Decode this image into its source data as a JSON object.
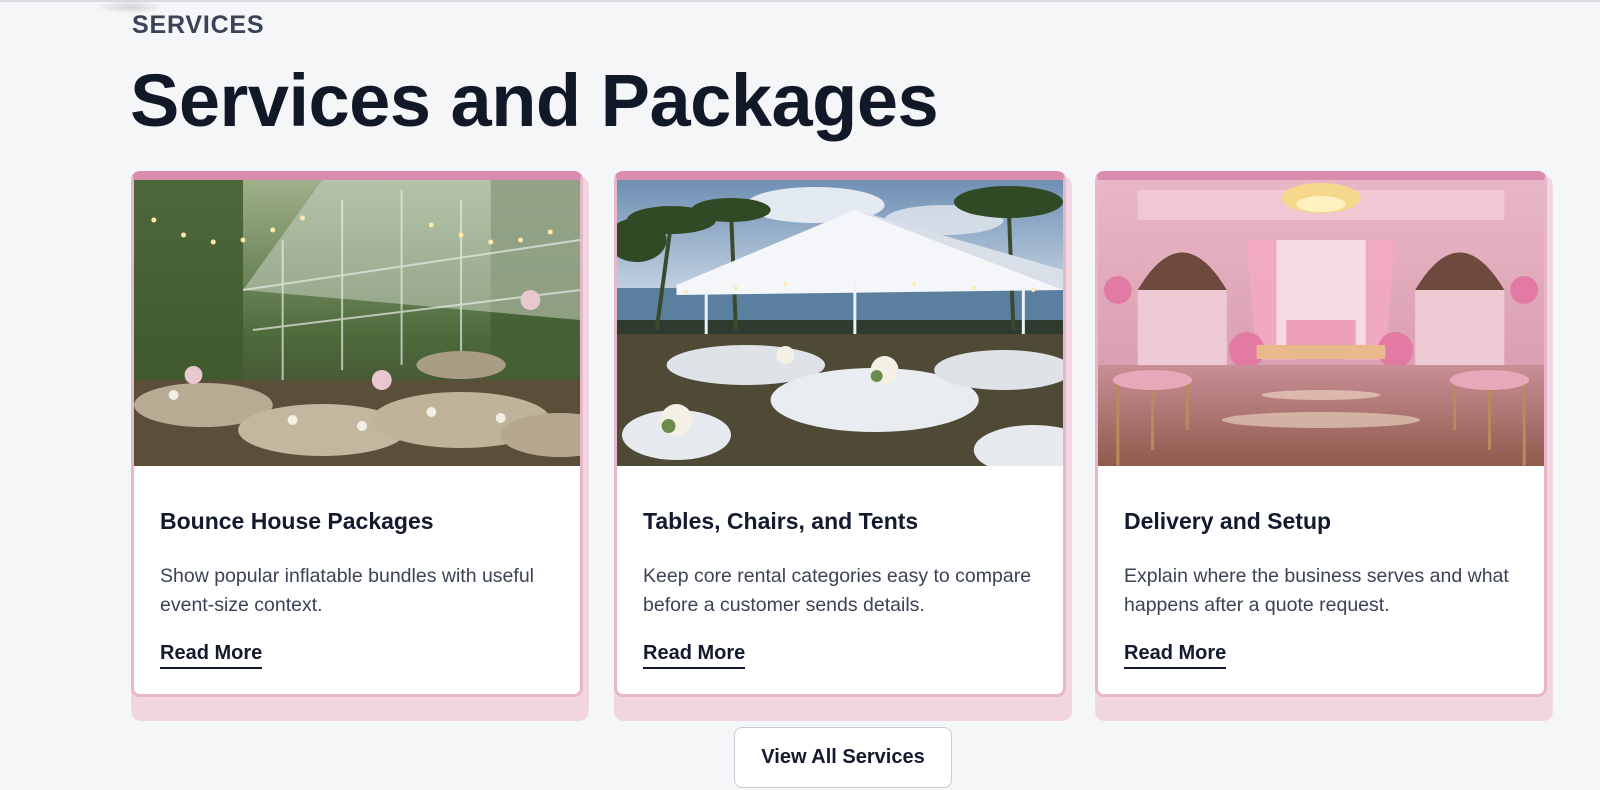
{
  "section": {
    "eyebrow": "SERVICES",
    "title": "Services and Packages"
  },
  "cards": [
    {
      "title": "Bounce House Packages",
      "description": "Show popular inflatable bundles with useful event-size context.",
      "link_label": "Read More",
      "image_subject": "greenhouse-garden-event-photo"
    },
    {
      "title": "Tables, Chairs, and Tents",
      "description": "Keep core rental categories easy to compare before a customer sends details.",
      "link_label": "Read More",
      "image_subject": "beach-tent-reception-photo"
    },
    {
      "title": "Delivery and Setup",
      "description": "Explain where the business serves and what happens after a quote request.",
      "link_label": "Read More",
      "image_subject": "pink-ballroom-photo"
    }
  ],
  "cta": {
    "label": "View All Services"
  },
  "colors": {
    "accent_pink": "#d98cae",
    "card_shadow_pink": "#f1d6e2",
    "heading_navy": "#111827",
    "page_background": "#f5f6f7"
  }
}
